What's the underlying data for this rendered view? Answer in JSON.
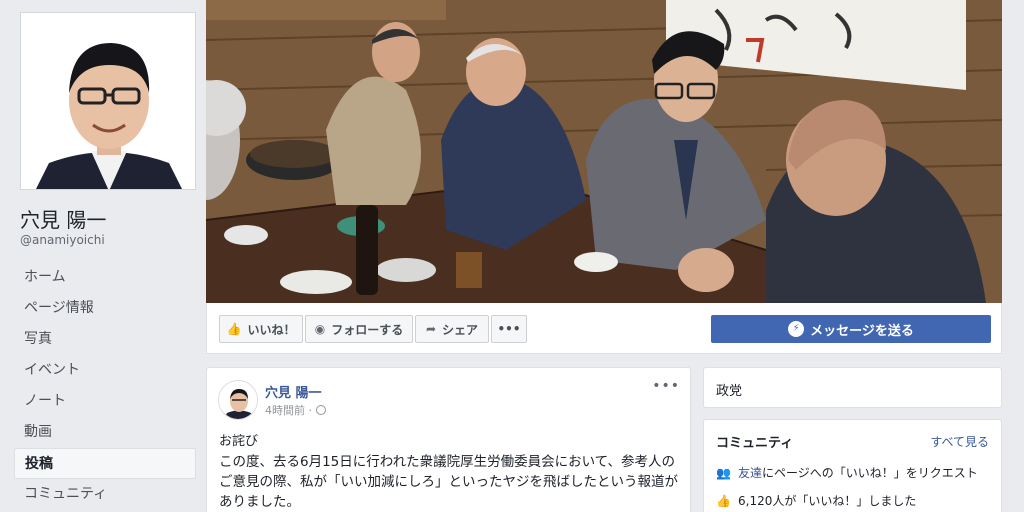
{
  "page": {
    "name": "穴見 陽一",
    "handle": "@anamiyoichi"
  },
  "nav": [
    {
      "label": "ホーム"
    },
    {
      "label": "ページ情報"
    },
    {
      "label": "写真"
    },
    {
      "label": "イベント"
    },
    {
      "label": "ノート"
    },
    {
      "label": "動画"
    },
    {
      "label": "投稿"
    },
    {
      "label": "コミュニティ"
    }
  ],
  "actions": {
    "like": "いいね！",
    "follow": "フォローする",
    "share": "シェア",
    "more": "•••",
    "message": "メッセージを送る"
  },
  "post": {
    "author": "穴見 陽一",
    "time": "4時間前 ·",
    "title": "お詫び",
    "body": "この度、去る6月15日に行われた衆議院厚生労働委員会において、参考人のご意見の際、私が「いい加減にしろ」といったヤジを飛ばしたという報道がありました。",
    "more": "•••"
  },
  "category": {
    "label": "政党"
  },
  "community": {
    "title": "コミュニティ",
    "see_all": "すべて見る",
    "invite_link": "友達",
    "invite_text": "にページへの「いいね！」をリクエスト",
    "likes_text": "6,120人が「いいね！」しました"
  },
  "colors": {
    "brand": "#4267b2",
    "link": "#385898",
    "background": "#e9ebee"
  }
}
